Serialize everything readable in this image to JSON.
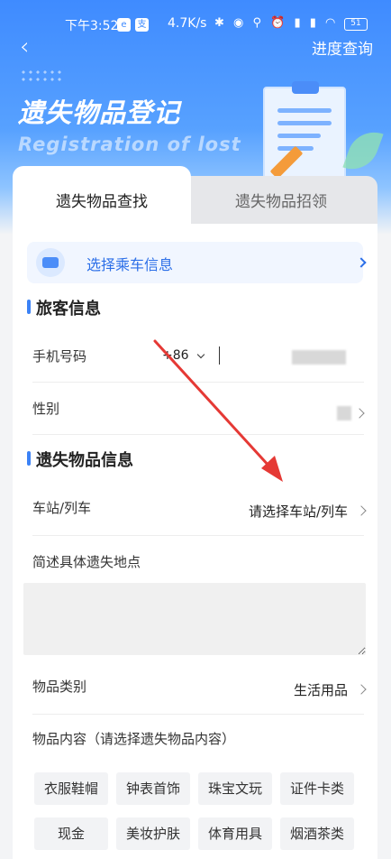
{
  "status_bar": {
    "time": "下午3:52",
    "badge_e": "e",
    "badge_2": "支",
    "speed": "4.7K/s",
    "icons": "✱ ◉ ⚲ ⏰ ▮ ▮ ◠",
    "battery": "51"
  },
  "nav": {
    "back": "‹",
    "progress_query": "进度查询"
  },
  "hero": {
    "title": "遗失物品登记",
    "subtitle": "Registration of lost"
  },
  "tabs": [
    {
      "label": "遗失物品查找",
      "active": true
    },
    {
      "label": "遗失物品招领",
      "active": false
    }
  ],
  "ride": {
    "label": "选择乘车信息"
  },
  "passenger": {
    "section_title": "旅客信息",
    "phone_label": "手机号码",
    "country_code": "+86",
    "gender_label": "性别"
  },
  "item_info": {
    "section_title": "遗失物品信息",
    "station_label": "车站/列车",
    "station_value": "请选择车站/列车",
    "location_label": "简述具体遗失地点",
    "category_label": "物品类别",
    "category_value": "生活用品",
    "content_label": "物品内容（请选择遗失物品内容）",
    "tags": [
      "衣服鞋帽",
      "钟表首饰",
      "珠宝文玩",
      "证件卡类",
      "现金",
      "美妆护肤",
      "体育用具",
      "烟酒茶类"
    ]
  },
  "colors": {
    "accent": "#2c6fe8",
    "hero": "#4b8df8",
    "annotation_arrow": "#e53935"
  }
}
